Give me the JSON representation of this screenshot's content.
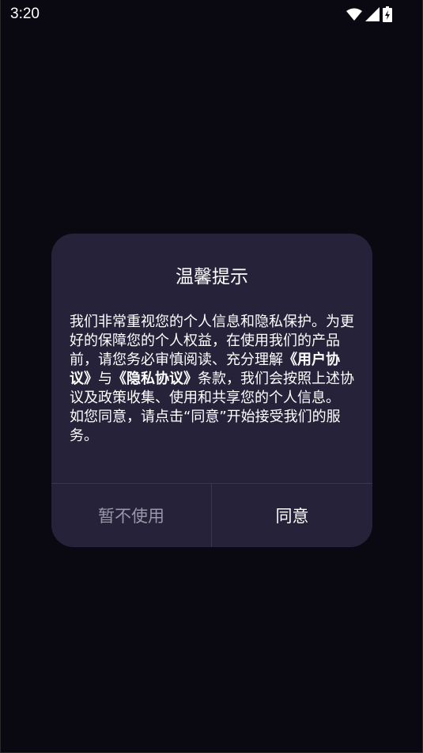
{
  "status_bar": {
    "time": "3:20",
    "icons": [
      "wifi-icon",
      "signal-icon",
      "battery-charging-icon"
    ]
  },
  "dialog": {
    "title": "温馨提示",
    "body": {
      "part1": "我们非常重视您的个人信息和隐私保护。为更好的保障您的个人权益，在使用我们的产品前，请您务必审慎阅读、充分理解",
      "link_user_agreement": "《用户协议》",
      "connector": "与",
      "link_privacy_policy": "《隐私协议》",
      "part2": "条款，我们会按照上述协议及政策收集、使用和共享您的个人信息。",
      "part3": "如您同意，请点击“同意”开始接受我们的服务。"
    },
    "buttons": {
      "decline": "暂不使用",
      "agree": "同意"
    }
  },
  "colors": {
    "background": "#0a0810",
    "dialog": "#25223a",
    "decline_text": "#9a97a8",
    "agree_text": "#ffffff"
  }
}
